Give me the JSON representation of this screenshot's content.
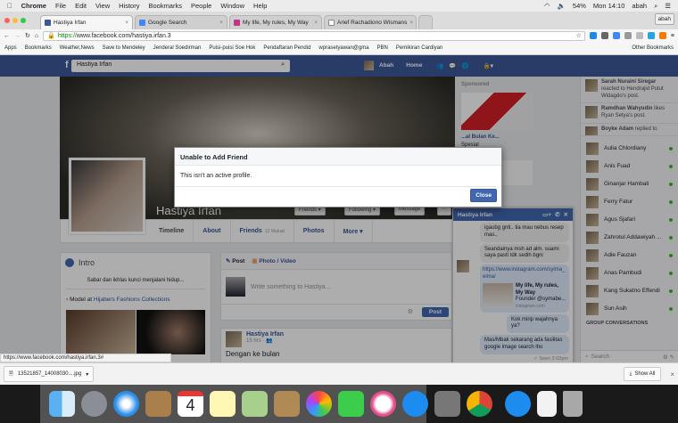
{
  "menubar": {
    "items": [
      "Chrome",
      "File",
      "Edit",
      "View",
      "History",
      "Bookmarks",
      "People",
      "Window",
      "Help"
    ],
    "battery": "54%",
    "clock": "Mon 14:10",
    "user": "abah"
  },
  "tabs": [
    {
      "label": "Hastiya Irfan",
      "color": "#3b5998"
    },
    {
      "label": "Google Search",
      "color": "#4285f4"
    },
    {
      "label": "My life, My rules, My Way",
      "color": "#c13584"
    },
    {
      "label": "Arief Rachadiono Wismans",
      "color": "#888888"
    }
  ],
  "profile_button": "abah",
  "address": {
    "scheme": "https://",
    "url": "www.facebook.com/hastiya.irfan.3"
  },
  "bookmarks": {
    "items": [
      "Apps",
      "Bookmarks",
      "Weather,News",
      "Save to Mendeley",
      "Jenderal Soedirman",
      "Puisi-puisi Soe Hok",
      "Pendaftaran Pendid",
      "wprasetyawan@gma",
      "PBN",
      "Pemikiran Cardiyan"
    ],
    "other": "Other Bookmarks"
  },
  "fb": {
    "search_value": "Hastiya Irfan",
    "user": "Abah",
    "home": "Home",
    "profile_name": "Hastiya Irfan",
    "cover_buttons": [
      "Friends",
      "Following",
      "Message",
      "···"
    ],
    "nav": [
      {
        "label": "Timeline"
      },
      {
        "label": "About"
      },
      {
        "label": "Friends",
        "sub": "12 Mutual"
      },
      {
        "label": "Photos"
      },
      {
        "label": "More ▾"
      }
    ],
    "intro": {
      "title": "Intro",
      "bio": "Sabar dan ikhlas kunci menjalani hidup...",
      "work_prefix": "Model at",
      "work_link": "Hijabers Fashions Collections"
    },
    "composer": {
      "post_tab": "Post",
      "photo_tab": "Photo / Video",
      "placeholder": "Write something to Hastiya...",
      "post_button": "Post"
    },
    "post": {
      "author": "Hastiya Irfan",
      "time": "15 hrs · ",
      "text": "Dengan ke bulan"
    },
    "sponsored": {
      "label": "Sponsored",
      "ad1_title": "...al Bulan Ke...",
      "ad1_sub": "Spesial"
    },
    "ticker": [
      {
        "name": "Sarah Nuraini Siregar",
        "text": "reacted to Hendrajid Putut Widagdo's post."
      },
      {
        "name": "Ramdhan Wahyudin",
        "text": "likes Ryan Setya's post."
      },
      {
        "name": "Boyke Adam",
        "text": "replied to"
      }
    ],
    "chat_list": [
      "Aulia Chlordiany",
      "Anis Fuad",
      "Ginanjar Hambali",
      "Ferry Fatur",
      "Agus Sjafari",
      "Zahrotul Addawiyah ...",
      "Adie Fauzan",
      "Anas Pambudi",
      "Kang Sukatno Effendi",
      "Sun Asih"
    ],
    "group_header": "GROUP CONVERSATIONS",
    "chat_search": "Search",
    "chat_window": {
      "title": "Hastiya Irfan",
      "messages": [
        "igaubg gnti.. tia mau nebus resep mas..",
        "Seandainya msh ad alm. suami saya pasti tdk sedih bgni"
      ],
      "link": "https://www.instagram.com/syima_eima/",
      "link_title": "My life, My rules, My Way",
      "link_desc": "Founder @symabe...",
      "link_domain": "instagram.com",
      "my_messages": [
        "Kok mirip wajahnya ya?",
        "Mas/Mbak sekarang ada fasilitas google image search lho"
      ],
      "seen": "✓ Seen 2:02pm"
    }
  },
  "dialog": {
    "title": "Unable to Add Friend",
    "body": "This isn't an active profile.",
    "close": "Close"
  },
  "status_url": "https://www.facebook.com/hastiya.irfan.3#",
  "download": {
    "file": "13521857_14008030....jpg",
    "show_all": "Show All"
  },
  "dock": [
    "finder",
    "launchpad",
    "safari",
    "contacts",
    "calendar",
    "notes",
    "maps",
    "archive-utility",
    "photos",
    "facetime",
    "itunes",
    "app-store",
    "system-preferences",
    "chrome",
    "app-store-downloads",
    "docx-file",
    "trash"
  ],
  "calendar_day": "4"
}
